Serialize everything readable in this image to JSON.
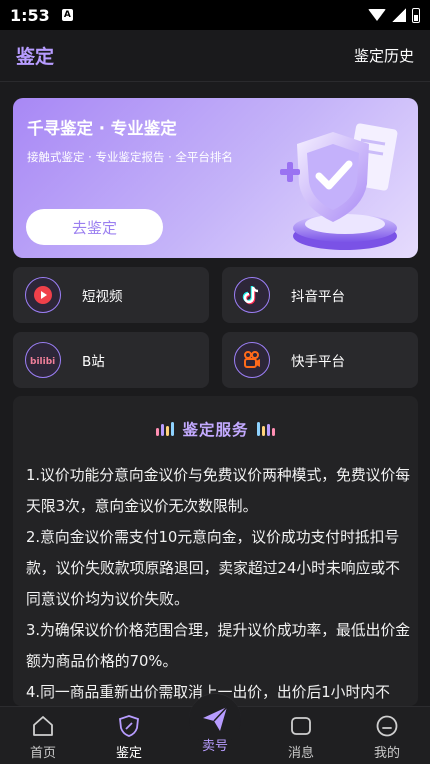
{
  "status_bar": {
    "time": "1:53",
    "notification": "A"
  },
  "header": {
    "title": "鉴定",
    "history_link": "鉴定历史"
  },
  "banner": {
    "title": "千寻鉴定 · 专业鉴定",
    "subtitle": "接触式鉴定 · 专业鉴定报告 · 全平台排名",
    "button": "去鉴定",
    "art_icon": "shield-check-icon"
  },
  "platforms": [
    {
      "label": "短视频",
      "icon": "video-play-icon"
    },
    {
      "label": "抖音平台",
      "icon": "tiktok-icon"
    },
    {
      "label": "B站",
      "icon": "bilibili-icon"
    },
    {
      "label": "快手平台",
      "icon": "kuaishou-icon"
    }
  ],
  "service": {
    "title": "鉴定服务",
    "paragraphs": [
      "1.议价功能分意向金议价与免费议价两种模式，免费议价每天限3次，意向金议价无次数限制。",
      "2.意向金议价需支付10元意向金，议价成功支付时抵扣号款，议价失败款项原路退回，卖家超过24小时未响应或不同意议价均为议价失败。",
      "3.为确保议价价格范围合理，提升议价成功率，最低出价金额为商品价格的70%。",
      "4.同一商品重新出价需取消上一出价，出价后1小时内不"
    ]
  },
  "bottom_nav": [
    {
      "label": "首页",
      "icon": "home-icon"
    },
    {
      "label": "鉴定",
      "icon": "shield-icon"
    },
    {
      "label": "卖号",
      "icon": "send-icon"
    },
    {
      "label": "消息",
      "icon": "message-icon"
    },
    {
      "label": "我的",
      "icon": "profile-icon"
    }
  ],
  "colors": {
    "accent": "#b79cff",
    "banner_start": "#a888f5",
    "banner_end": "#e6dcfd",
    "background": "#1b1b1d"
  }
}
